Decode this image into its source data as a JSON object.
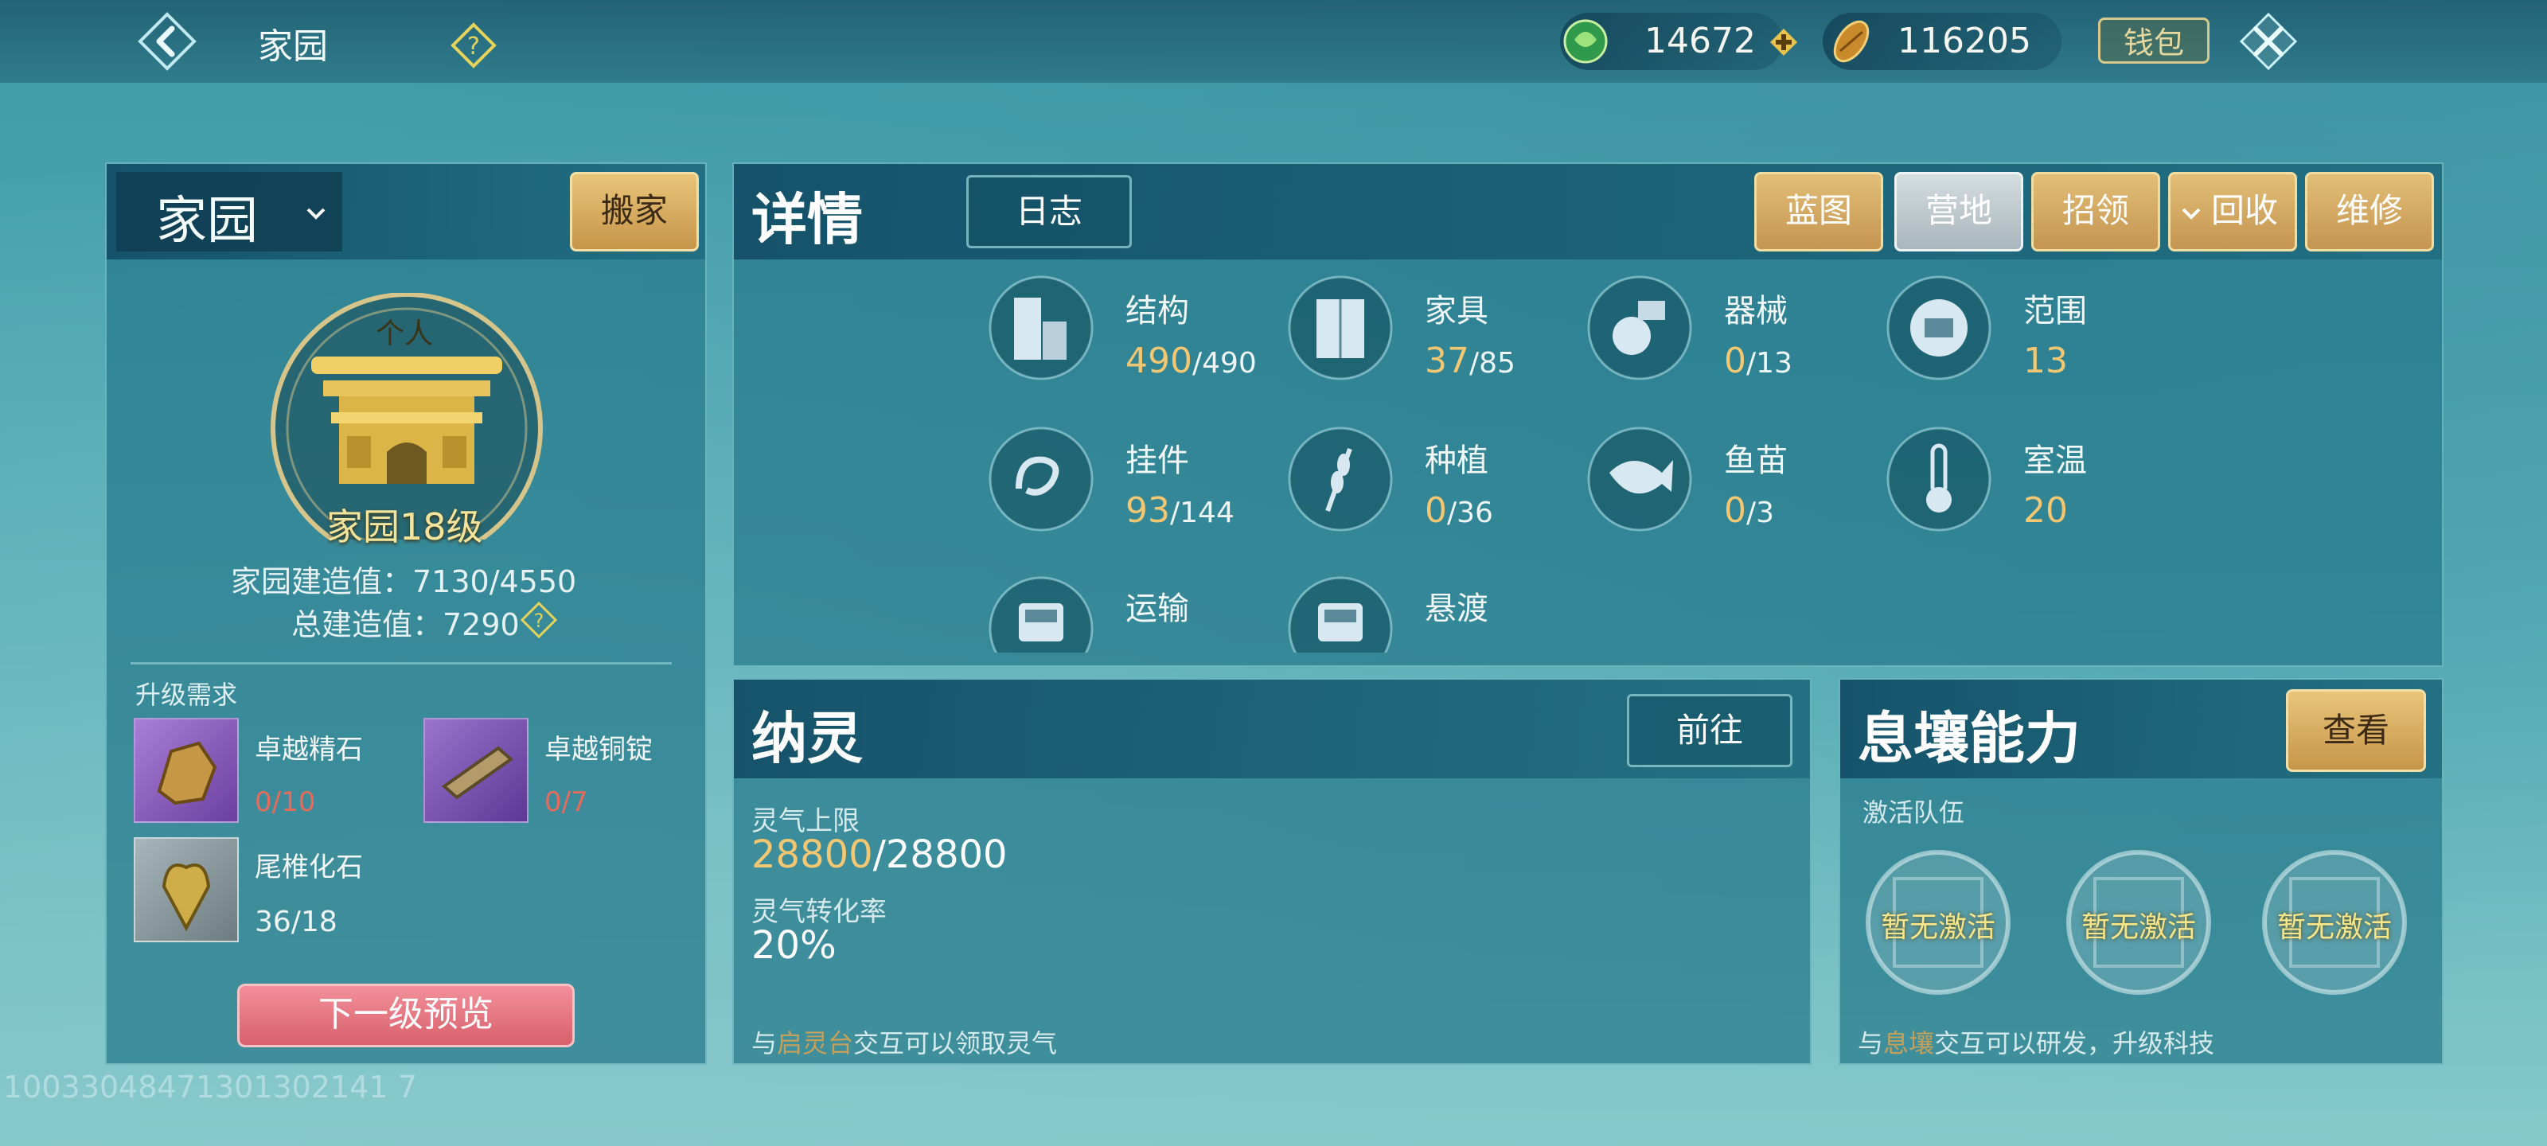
{
  "header": {
    "title": "家园",
    "jade": "14672",
    "coins": "116205",
    "wallet_label": "钱包"
  },
  "homestead": {
    "title": "家园",
    "move_label": "搬家",
    "badge_top": "个人",
    "level_label": "家园18级",
    "build_value": "家园建造值：7130/4550",
    "total_build_value": "总建造值：7290",
    "upgrade_title": "升级需求",
    "materials": [
      {
        "name": "卓越精石",
        "count": "0/10",
        "color": "#9b6bc9"
      },
      {
        "name": "卓越铜锭",
        "count": "0/7",
        "color": "#8b5fc2"
      },
      {
        "name": "尾椎化石",
        "count": "36/18",
        "color": "#8a9aa0"
      }
    ],
    "preview_label": "下一级预览"
  },
  "details": {
    "title": "详情",
    "log_tab": "日志",
    "buttons": [
      "蓝图",
      "营地",
      "招领",
      "回收",
      "维修"
    ],
    "active_button": "营地",
    "stats": [
      {
        "name": "结构",
        "value": "490",
        "max": "/490",
        "icon": "building-icon"
      },
      {
        "name": "家具",
        "value": "37",
        "max": "/85",
        "icon": "wardrobe-icon"
      },
      {
        "name": "器械",
        "value": "0",
        "max": "/13",
        "icon": "machine-icon"
      },
      {
        "name": "范围",
        "value": "13",
        "max": "",
        "icon": "range-icon"
      },
      {
        "name": "挂件",
        "value": "93",
        "max": "/144",
        "icon": "pendant-icon"
      },
      {
        "name": "种植",
        "value": "0",
        "max": "/36",
        "icon": "wheat-icon"
      },
      {
        "name": "鱼苗",
        "value": "0",
        "max": "/3",
        "icon": "fish-icon"
      },
      {
        "name": "室温",
        "value": "20",
        "max": "",
        "icon": "thermometer-icon"
      },
      {
        "name": "运输",
        "value": "",
        "max": "",
        "icon": "tram-icon"
      },
      {
        "name": "悬渡",
        "value": "",
        "max": "",
        "icon": "cablecar-icon"
      }
    ]
  },
  "naling": {
    "title": "纳灵",
    "goto_label": "前往",
    "cap_label": "灵气上限",
    "cap_value": "28800",
    "cap_max": "/28800",
    "rate_label": "灵气转化率",
    "rate_value": "20%",
    "hint_prefix": "与",
    "hint_target": "启灵台",
    "hint_suffix": "交互可以领取灵气"
  },
  "xirang": {
    "title": "息壤能力",
    "view_label": "查看",
    "team_label": "激活队伍",
    "slots": [
      "暂无激活",
      "暂无激活",
      "暂无激活"
    ],
    "hint_prefix": "与",
    "hint_target": "息壤",
    "hint_suffix": "交互可以研发，升级科技"
  },
  "footer_id": "10033048471301302141 7"
}
